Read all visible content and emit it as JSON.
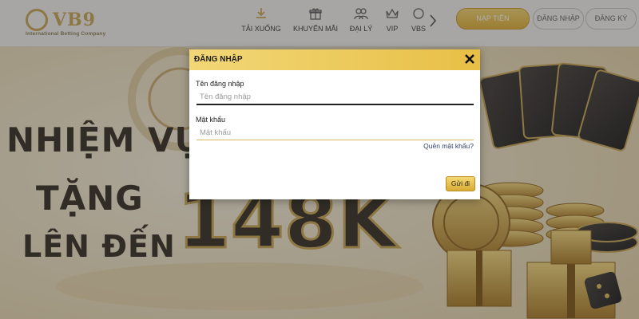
{
  "header": {
    "logo": {
      "brand": "VB9",
      "tagline": "International Betting Company"
    },
    "nav": [
      {
        "label": "TẢI XUỐNG",
        "icon": "download-icon"
      },
      {
        "label": "KHUYẾN MÃI",
        "icon": "gift-icon"
      },
      {
        "label": "ĐẠI LÝ",
        "icon": "agents-icon"
      },
      {
        "label": "VIP",
        "icon": "crown-icon"
      },
      {
        "label": "VBS",
        "icon": "vbs-icon"
      }
    ],
    "deposit_label": "NẠP TIỀN",
    "login_label": "ĐĂNG NHẬP",
    "register_label": "ĐĂNG KÝ"
  },
  "banner": {
    "line1": "NHIỆM VỤ",
    "line2": "TẶNG",
    "line3": "LÊN ĐẾN",
    "amount": "148K"
  },
  "modal": {
    "title": "ĐĂNG NHẬP",
    "username_label": "Tên đăng nhập",
    "username_placeholder": "Tên đăng nhập",
    "password_label": "Mật khẩu",
    "password_placeholder": "Mật khẩu",
    "forgot_label": "Quên mật khẩu?",
    "submit_label": "Gửi đi"
  },
  "colors": {
    "gold": "#e1ae2b",
    "accent": "#c9a24a"
  }
}
